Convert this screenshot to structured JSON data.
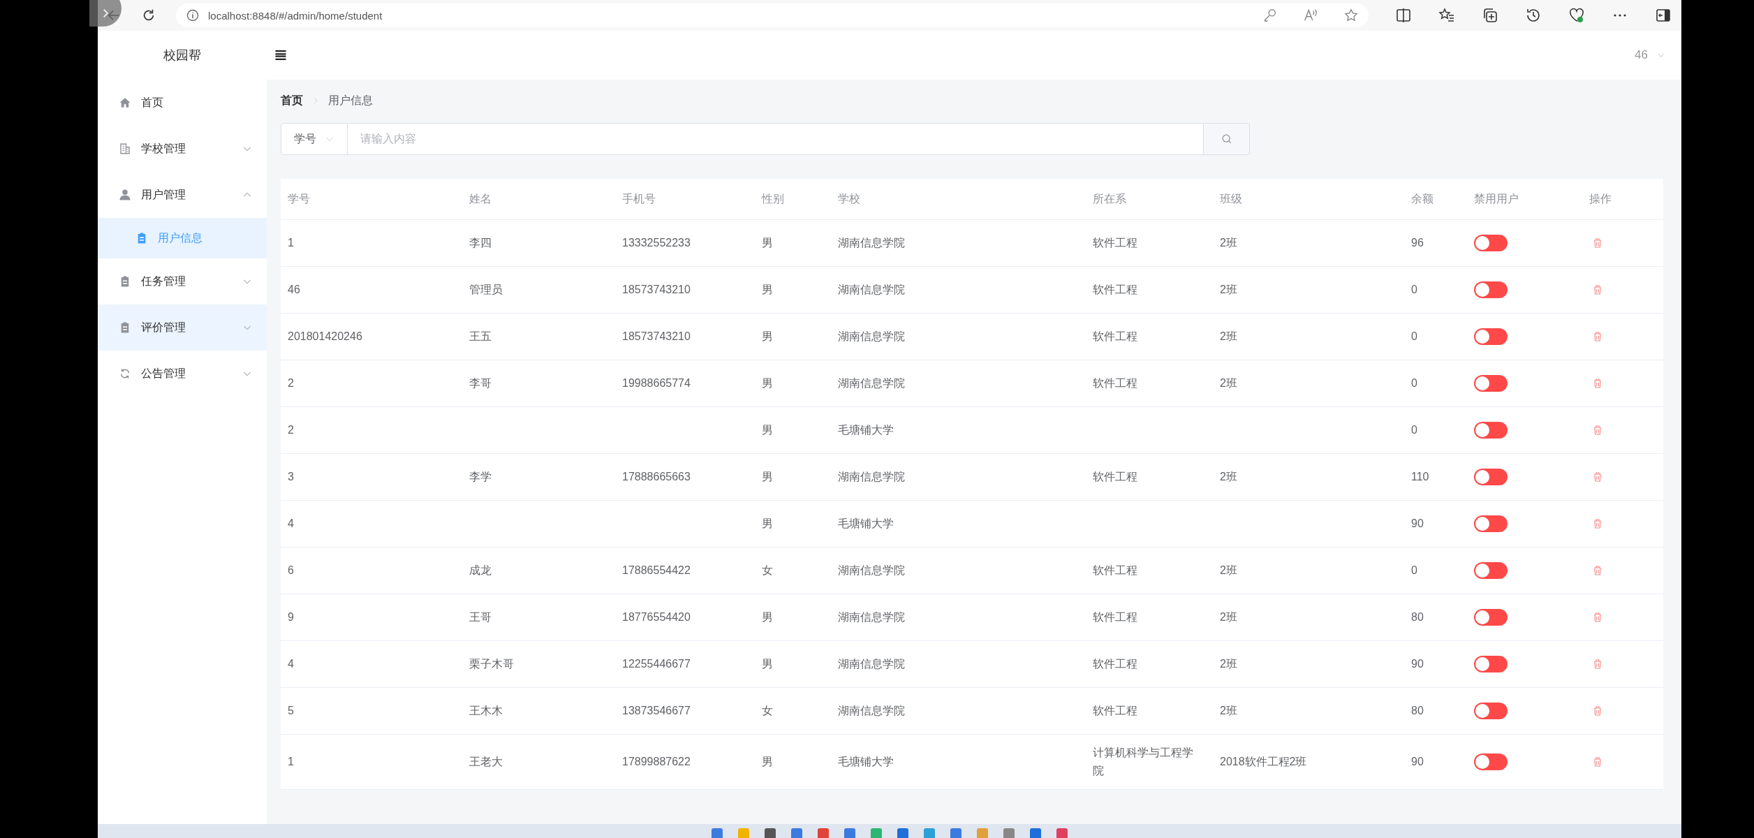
{
  "browser": {
    "url": "localhost:8848/#/admin/home/student"
  },
  "sidebar": {
    "title": "校园帮",
    "items": [
      {
        "label": "首页",
        "kind": "link",
        "hovered": false
      },
      {
        "label": "学校管理",
        "kind": "menu",
        "expanded": false,
        "hovered": false
      },
      {
        "label": "用户管理",
        "kind": "menu",
        "expanded": true,
        "hovered": false,
        "children": [
          {
            "label": "用户信息",
            "selected": true
          }
        ]
      },
      {
        "label": "任务管理",
        "kind": "menu",
        "expanded": false,
        "hovered": false
      },
      {
        "label": "评价管理",
        "kind": "menu",
        "expanded": false,
        "hovered": true
      },
      {
        "label": "公告管理",
        "kind": "menu",
        "expanded": false,
        "hovered": false
      }
    ]
  },
  "header": {
    "user": "46"
  },
  "breadcrumb": [
    "首页",
    "用户信息"
  ],
  "search": {
    "field": "学号",
    "placeholder": "请输入内容"
  },
  "table": {
    "columns": [
      "学号",
      "姓名",
      "手机号",
      "性别",
      "学校",
      "所在系",
      "班级",
      "余额",
      "禁用用户",
      "操作"
    ],
    "rows": [
      {
        "id": "1",
        "name": "李四",
        "phone": "13332552233",
        "gender": "男",
        "school": "湖南信息学院",
        "department": "软件工程",
        "class": "2班",
        "balance": "96",
        "disabled_user": false
      },
      {
        "id": "46",
        "name": "管理员",
        "phone": "18573743210",
        "gender": "男",
        "school": "湖南信息学院",
        "department": "软件工程",
        "class": "2班",
        "balance": "0",
        "disabled_user": false
      },
      {
        "id": "201801420246",
        "name": "王五",
        "phone": "18573743210",
        "gender": "男",
        "school": "湖南信息学院",
        "department": "软件工程",
        "class": "2班",
        "balance": "0",
        "disabled_user": false
      },
      {
        "id": "2",
        "name": "李哥",
        "phone": "19988665774",
        "gender": "男",
        "school": "湖南信息学院",
        "department": "软件工程",
        "class": "2班",
        "balance": "0",
        "disabled_user": false
      },
      {
        "id": "2",
        "gender": "男",
        "school": "毛塘铺大学",
        "balance": "0",
        "disabled_user": false
      },
      {
        "id": "3",
        "name": "李学",
        "phone": "17888665663",
        "gender": "男",
        "school": "湖南信息学院",
        "department": "软件工程",
        "class": "2班",
        "balance": "110",
        "disabled_user": false
      },
      {
        "id": "4",
        "gender": "男",
        "school": "毛塘铺大学",
        "balance": "90",
        "disabled_user": false
      },
      {
        "id": "6",
        "name": "成龙",
        "phone": "17886554422",
        "gender": "女",
        "school": "湖南信息学院",
        "department": "软件工程",
        "class": "2班",
        "balance": "0",
        "disabled_user": false
      },
      {
        "id": "9",
        "name": "王哥",
        "phone": "18776554420",
        "gender": "男",
        "school": "湖南信息学院",
        "department": "软件工程",
        "class": "2班",
        "balance": "80",
        "disabled_user": false
      },
      {
        "id": "4",
        "name": "栗子木哥",
        "phone": "12255446677",
        "gender": "男",
        "school": "湖南信息学院",
        "department": "软件工程",
        "class": "2班",
        "balance": "90",
        "disabled_user": false
      },
      {
        "id": "5",
        "name": "王木木",
        "phone": "13873546677",
        "gender": "女",
        "school": "湖南信息学院",
        "department": "软件工程",
        "class": "2班",
        "balance": "80",
        "disabled_user": false
      },
      {
        "id": "1",
        "name": "王老大",
        "phone": "17899887622",
        "gender": "男",
        "school": "毛塘铺大学",
        "department": "计算机科学与工程学院",
        "class": "2018软件工程2班",
        "balance": "90",
        "disabled_user": false
      }
    ]
  }
}
